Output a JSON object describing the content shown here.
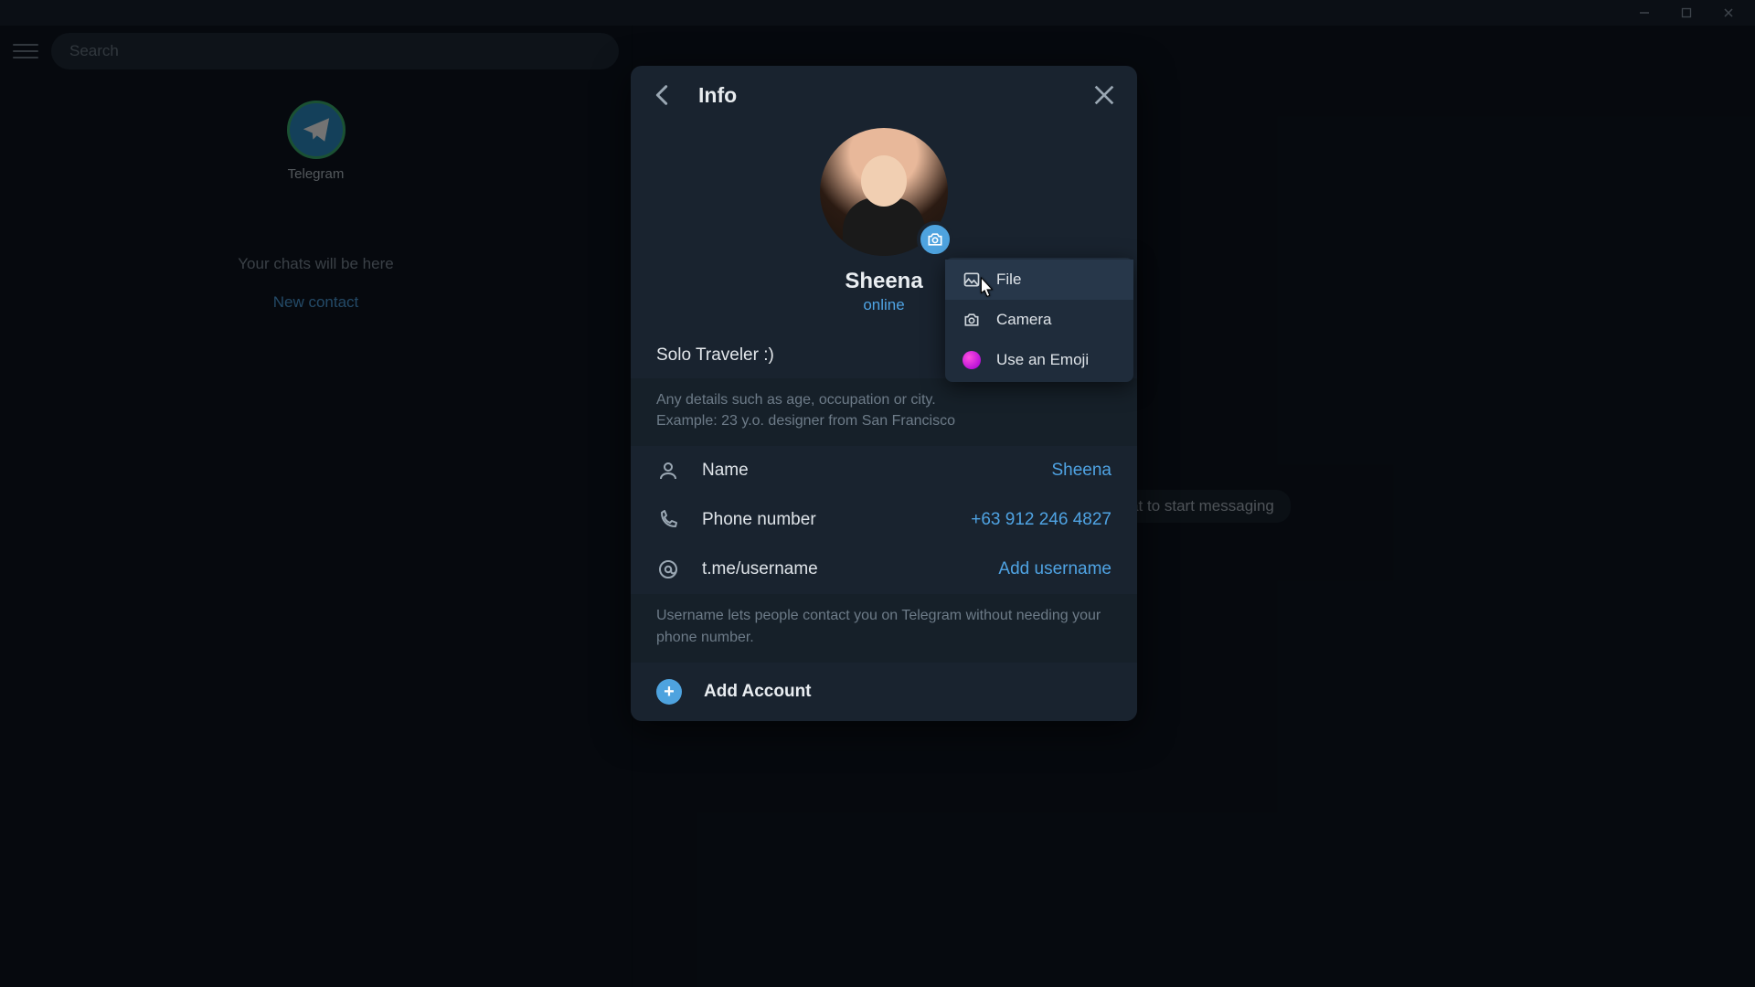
{
  "window": {
    "minimize_icon": "minimize-icon",
    "maximize_icon": "maximize-icon",
    "close_icon": "close-icon"
  },
  "sidebar": {
    "search_placeholder": "Search",
    "chats": [
      {
        "name": "Telegram"
      }
    ],
    "empty_text": "Your chats will be here",
    "new_contact_label": "New contact"
  },
  "chat_area": {
    "placeholder": "chat to start messaging"
  },
  "info_modal": {
    "title": "Info",
    "profile": {
      "name": "Sheena",
      "status": "online",
      "bio": "Solo Traveler :)"
    },
    "bio_hint_line1": "Any details such as age, occupation or city.",
    "bio_hint_line2": "Example: 23 y.o. designer from San Francisco",
    "rows": {
      "name": {
        "label": "Name",
        "value": "Sheena"
      },
      "phone": {
        "label": "Phone number",
        "value": "+63 912 246 4827"
      },
      "user": {
        "label": "t.me/username",
        "value": "Add username"
      }
    },
    "username_hint": "Username lets people contact you on Telegram without needing your phone number.",
    "add_account_label": "Add Account"
  },
  "photo_menu": {
    "file": "File",
    "camera": "Camera",
    "emoji": "Use an Emoji"
  }
}
